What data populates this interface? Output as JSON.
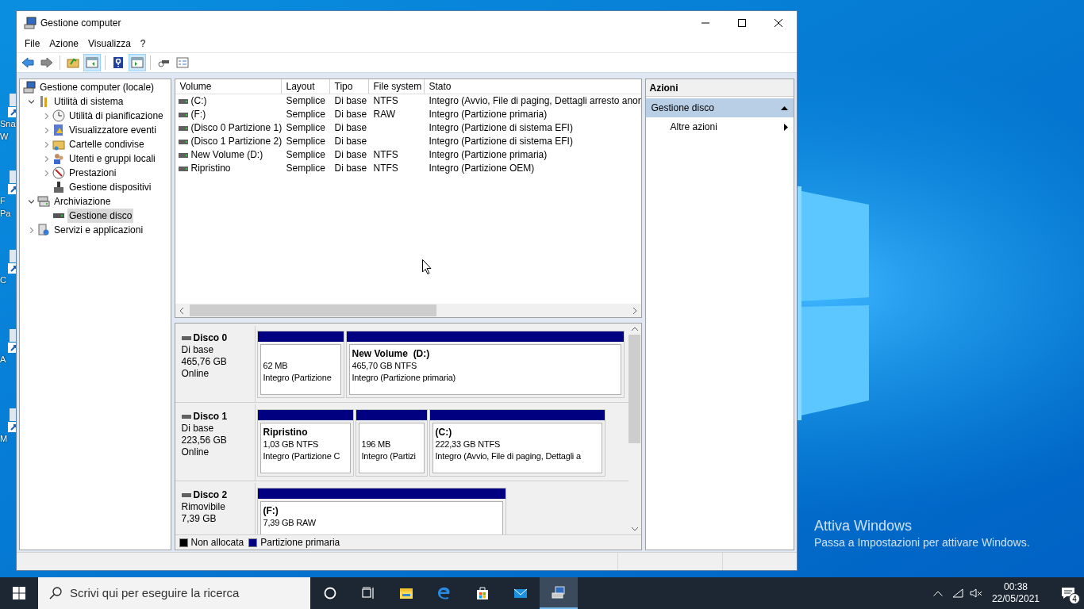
{
  "desktop": {
    "icons": [
      {
        "label_lines": [
          "Sna",
          "W"
        ]
      },
      {
        "label_lines": [
          "F",
          "Pa"
        ]
      },
      {
        "label_lines": [
          "C"
        ]
      },
      {
        "label_lines": [
          "A"
        ]
      },
      {
        "label_lines": [
          "M"
        ]
      }
    ],
    "activation": {
      "title": "Attiva Windows",
      "text": "Passa a Impostazioni per attivare Windows."
    }
  },
  "window": {
    "title": "Gestione computer"
  },
  "menu": [
    "File",
    "Azione",
    "Visualizza",
    "?"
  ],
  "toolbar": [
    {
      "pressed": false
    },
    {
      "pressed": false
    },
    {
      "pressed": false
    },
    {
      "pressed": true
    },
    {
      "pressed": false
    },
    {
      "pressed": true
    },
    {
      "pressed": false
    },
    {
      "pressed": false
    }
  ],
  "tree": [
    {
      "label": "Gestione computer (locale)",
      "selected": false,
      "children": [
        {
          "label": "Utilità di sistema",
          "expanded": true,
          "selected": false,
          "children": [
            {
              "label": "Utilità di pianificazione",
              "expanded": false,
              "selected": false
            },
            {
              "label": "Visualizzatore eventi",
              "expanded": false,
              "selected": false
            },
            {
              "label": "Cartelle condivise",
              "expanded": false,
              "selected": false
            },
            {
              "label": "Utenti e gruppi locali",
              "expanded": false,
              "selected": false
            },
            {
              "label": "Prestazioni",
              "expanded": false,
              "selected": false
            },
            {
              "label": "Gestione dispositivi",
              "selected": false
            }
          ]
        },
        {
          "label": "Archiviazione",
          "expanded": true,
          "selected": false,
          "children": [
            {
              "label": "Gestione disco",
              "selected": true
            }
          ]
        },
        {
          "label": "Servizi e applicazioni",
          "expanded": false,
          "selected": false
        }
      ]
    }
  ],
  "volumes": {
    "columns": [
      "Volume",
      "Layout",
      "Tipo",
      "File system",
      "Stato"
    ],
    "rows": [
      {
        "cells": [
          "(C:)",
          "Semplice",
          "Di base",
          "NTFS",
          "Integro (Avvio, File di paging, Dettagli arresto anor"
        ]
      },
      {
        "cells": [
          "(F:)",
          "Semplice",
          "Di base",
          "RAW",
          "Integro (Partizione primaria)"
        ]
      },
      {
        "cells": [
          "(Disco 0 Partizione 1)",
          "Semplice",
          "Di base",
          "",
          "Integro (Partizione di sistema EFI)"
        ]
      },
      {
        "cells": [
          "(Disco 1 Partizione 2)",
          "Semplice",
          "Di base",
          "",
          "Integro (Partizione di sistema EFI)"
        ]
      },
      {
        "cells": [
          "New Volume (D:)",
          "Semplice",
          "Di base",
          "NTFS",
          "Integro (Partizione primaria)"
        ]
      },
      {
        "cells": [
          "Ripristino",
          "Semplice",
          "Di base",
          "NTFS",
          "Integro (Partizione OEM)"
        ]
      }
    ]
  },
  "disks": [
    {
      "name": "Disco 0",
      "lines": [
        "Di base",
        "465,76 GB",
        "Online"
      ],
      "partitions": [
        {
          "lines": [
            "62 MB",
            "Integro (Partizione"
          ]
        },
        {
          "title": "New Volume  (D:)",
          "lines": [
            "465,70 GB NTFS",
            "Integro (Partizione primaria)"
          ]
        }
      ]
    },
    {
      "name": "Disco 1",
      "lines": [
        "Di base",
        "223,56 GB",
        "Online"
      ],
      "partitions": [
        {
          "title": "Ripristino",
          "lines": [
            "1,03 GB NTFS",
            "Integro (Partizione C"
          ]
        },
        {
          "lines": [
            "196 MB",
            "Integro (Partizi"
          ]
        },
        {
          "title": "(C:)",
          "lines": [
            "222,33 GB NTFS",
            "Integro (Avvio, File di paging, Dettagli a"
          ]
        }
      ]
    },
    {
      "name": "Disco 2",
      "lines": [
        "Rimovibile",
        "7,39 GB"
      ],
      "partitions": [
        {
          "title": "(F:)",
          "lines": [
            "7,39 GB RAW"
          ]
        }
      ]
    }
  ],
  "legend": [
    {
      "label": "Non allocata",
      "color": "#000000"
    },
    {
      "label": "Partizione primaria",
      "color": "#000080"
    }
  ],
  "actions": {
    "title": "Azioni",
    "sections": [
      {
        "label": "Gestione disco",
        "expanded": true,
        "items": [
          "Altre azioni"
        ]
      }
    ]
  },
  "taskbar": {
    "search_placeholder": "Scrivi qui per eseguire la ricerca",
    "apps": [
      {
        "selected": false
      },
      {
        "selected": false
      },
      {
        "selected": false
      },
      {
        "selected": false
      },
      {
        "selected": false
      },
      {
        "selected": false
      },
      {
        "selected": true
      }
    ],
    "time": "00:38",
    "date": "22/05/2021",
    "notifications": "4"
  }
}
